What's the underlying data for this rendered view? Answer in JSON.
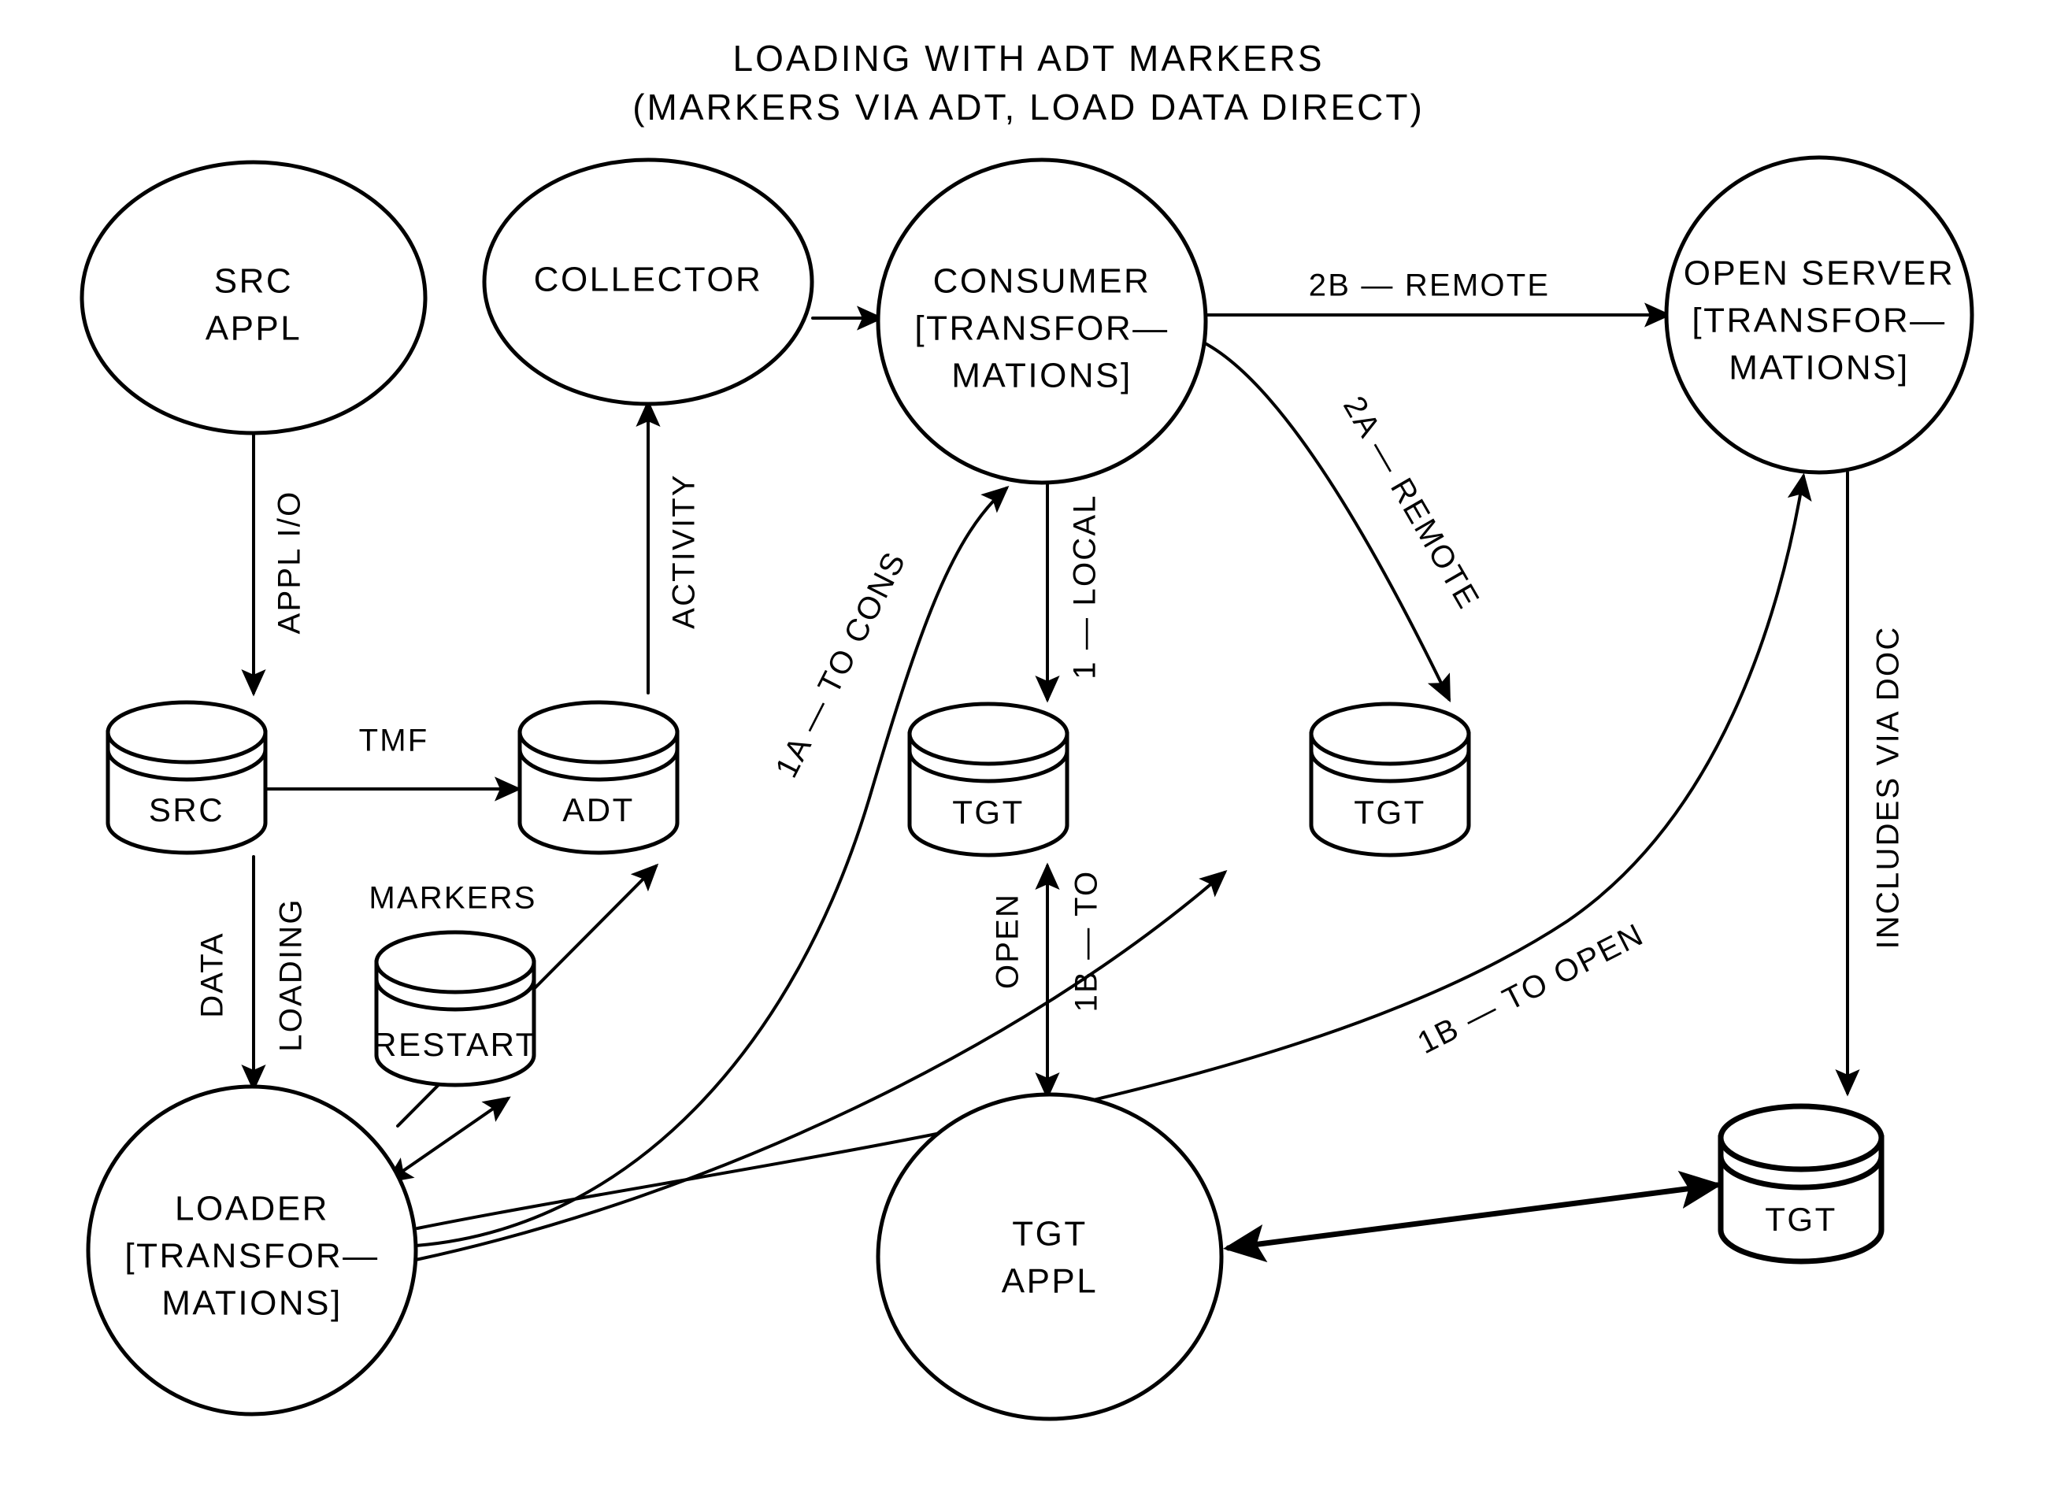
{
  "title": {
    "line1": "LOADING WITH ADT MARKERS",
    "line2": "(MARKERS VIA ADT, LOAD DATA DIRECT)"
  },
  "nodes": {
    "src_appl": {
      "lines": [
        "SRC",
        "APPL"
      ]
    },
    "collector": {
      "lines": [
        "COLLECTOR"
      ]
    },
    "consumer": {
      "lines": [
        "CONSUMER",
        "[TRANSFOR—",
        "MATIONS]"
      ]
    },
    "open_server": {
      "lines": [
        "OPEN SERVER",
        "[TRANSFOR—",
        "MATIONS]"
      ]
    },
    "loader": {
      "lines": [
        "LOADER",
        "[TRANSFOR—",
        "MATIONS]"
      ]
    },
    "tgt_appl": {
      "lines": [
        "TGT",
        "APPL"
      ]
    }
  },
  "stores": {
    "src": {
      "label": "SRC"
    },
    "adt": {
      "label": "ADT"
    },
    "restart": {
      "label": "RESTART"
    },
    "tgt_local": {
      "label": "TGT"
    },
    "tgt_remote": {
      "label": "TGT"
    },
    "tgt_open": {
      "label": "TGT"
    }
  },
  "edges": {
    "appl_io": {
      "label": "APPL I/O"
    },
    "activity": {
      "label": "ACTIVITY"
    },
    "tmf": {
      "label": "TMF"
    },
    "markers": {
      "label": "MARKERS"
    },
    "loading": {
      "label": "LOADING"
    },
    "data": {
      "label": "DATA"
    },
    "one_a_to_cons": {
      "label": "1A — TO CONS"
    },
    "one_local": {
      "label": "1 — LOCAL"
    },
    "two_a_remote": {
      "label": "2A — REMOTE"
    },
    "two_b_remote": {
      "label": "2B — REMOTE"
    },
    "one_b_to": {
      "label": "1B — TO"
    },
    "open": {
      "label": "OPEN"
    },
    "one_b_to_open": {
      "label": "1B — TO OPEN"
    },
    "includes_doc": {
      "label": "INCLUDES VIA DOC"
    }
  },
  "colors": {
    "stroke": "#000000",
    "background": "#ffffff"
  }
}
